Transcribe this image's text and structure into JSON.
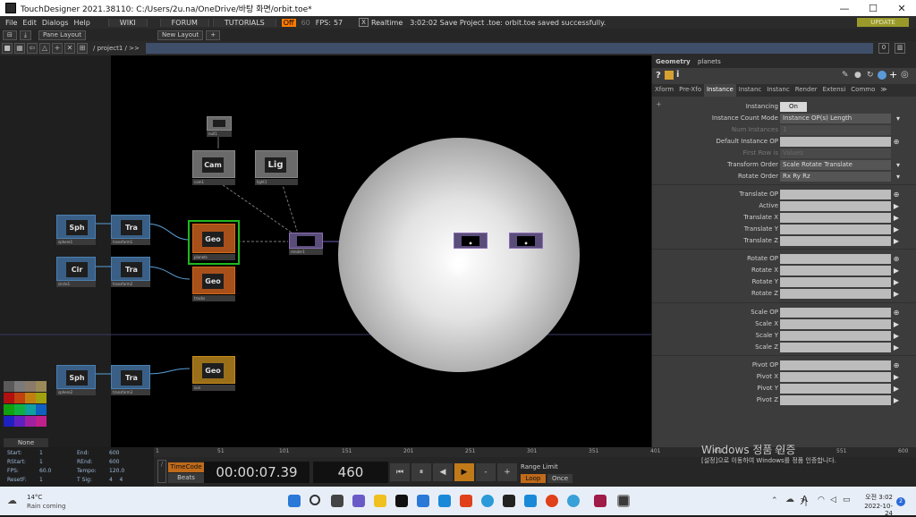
{
  "window": {
    "title": "TouchDesigner 2021.38110: C:/Users/2u.na/OneDrive/바탕 화면/orbit.toe*",
    "minimize": "—",
    "maximize": "☐",
    "close": "✕"
  },
  "menubar": {
    "items": [
      "File",
      "Edit",
      "Dialogs",
      "Help"
    ],
    "wiki": "WIKI",
    "forum": "FORUM",
    "tutorials": "TUTORIALS",
    "fps_box": "Off",
    "fps_cap": "60",
    "fps_label": "FPS:",
    "fps_value": "57",
    "realtime_check": "X",
    "realtime": "Realtime",
    "status": "3:02:02 Save Project .toe: orbit.toe saved successfully.",
    "update": "UPDATE"
  },
  "panebar": {
    "pane_layout": "Pane Layout",
    "new_layout": "New Layout",
    "add": "+"
  },
  "pathbar": {
    "path": "/ project1 / >>",
    "right_num": "0"
  },
  "network": {
    "ops": [
      {
        "name": "Sph",
        "sub": "sphere1"
      },
      {
        "name": "Tra",
        "sub": "transform1"
      },
      {
        "name": "Cir",
        "sub": "circle1"
      },
      {
        "name": "Tra",
        "sub": "transform2"
      },
      {
        "name": "Geo",
        "sub": "planets"
      },
      {
        "name": "Geo",
        "sub": "tracks"
      },
      {
        "name": "Cam",
        "sub": "cam1"
      },
      {
        "name": "Lig",
        "sub": "light1"
      },
      {
        "name": "",
        "sub": "null1"
      },
      {
        "name": "",
        "sub": "render1"
      },
      {
        "name": "Sph",
        "sub": "sphere2"
      },
      {
        "name": "Tra",
        "sub": "transform3"
      },
      {
        "name": "Geo",
        "sub": "sun"
      }
    ],
    "swatch_label": "None"
  },
  "params": {
    "op_type": "Geometry",
    "op_name": "planets",
    "tabs": [
      "Xform",
      "Pre-Xfo",
      "Instance",
      "Instanc",
      "Instanc",
      "Render",
      "Extensi",
      "Commo",
      "≫"
    ],
    "active_tab_index": 2,
    "rows": [
      {
        "label": "Instancing",
        "value": "On",
        "kind": "toggle"
      },
      {
        "label": "Instance Count Mode",
        "value": "Instance OP(s) Length",
        "kind": "dropdown"
      },
      {
        "label": "Num Instances",
        "value": "1",
        "kind": "disabled"
      },
      {
        "label": "Default Instance OP",
        "value": "",
        "kind": "field"
      },
      {
        "label": "First Row is",
        "value": "Values",
        "kind": "disabled"
      },
      {
        "label": "Transform Order",
        "value": "Scale Rotate Translate",
        "kind": "dropdown"
      },
      {
        "label": "Rotate Order",
        "value": "Rx Ry Rz",
        "kind": "dropdown"
      },
      {
        "label": "Translate OP",
        "value": "",
        "kind": "field"
      },
      {
        "label": "Active",
        "value": "",
        "kind": "field"
      },
      {
        "label": "Translate X",
        "value": "",
        "kind": "field"
      },
      {
        "label": "Translate Y",
        "value": "",
        "kind": "field"
      },
      {
        "label": "Translate Z",
        "value": "",
        "kind": "field"
      },
      {
        "label": "Rotate OP",
        "value": "",
        "kind": "field"
      },
      {
        "label": "Rotate X",
        "value": "",
        "kind": "field"
      },
      {
        "label": "Rotate Y",
        "value": "",
        "kind": "field"
      },
      {
        "label": "Rotate Z",
        "value": "",
        "kind": "field"
      },
      {
        "label": "Scale OP",
        "value": "",
        "kind": "field"
      },
      {
        "label": "Scale X",
        "value": "",
        "kind": "field"
      },
      {
        "label": "Scale Y",
        "value": "",
        "kind": "field"
      },
      {
        "label": "Scale Z",
        "value": "",
        "kind": "field"
      },
      {
        "label": "Pivot OP",
        "value": "",
        "kind": "field"
      },
      {
        "label": "Pivot X",
        "value": "",
        "kind": "field"
      },
      {
        "label": "Pivot Y",
        "value": "",
        "kind": "field"
      },
      {
        "label": "Pivot Z",
        "value": "",
        "kind": "field"
      }
    ]
  },
  "timeline": {
    "start_label": "Start:",
    "start": "1",
    "end_label": "End:",
    "end": "600",
    "rstart_label": "RStart:",
    "rstart": "1",
    "rend_label": "REnd:",
    "rend": "600",
    "fps_label": "FPS:",
    "fps": "60.0",
    "tempo_label": "Tempo:",
    "tempo": "120.0",
    "resetf_label": "ResetF:",
    "resetf": "1",
    "tsig_label": "T Sig:",
    "tsig": "4    4",
    "ticks": [
      "1",
      "51",
      "101",
      "151",
      "201",
      "251",
      "301",
      "351",
      "401",
      "451",
      "501",
      "551",
      "600"
    ],
    "timecode_btn": "TimeCode",
    "beats_btn": "Beats",
    "timecode": "00:00:07.39",
    "frame": "460",
    "range_limit": "Range Limit",
    "loop": "Loop",
    "once": "Once",
    "watermark_title": "Windows 정품 인증",
    "watermark_sub": "[설정]으로 이동하여 Windows를 정품 인증합니다."
  },
  "taskbar": {
    "temp": "14°C",
    "weather": "Rain coming",
    "ime": "A",
    "lang": "가",
    "time": "오전 3:02",
    "date": "2022-10-24",
    "notif": "2"
  }
}
